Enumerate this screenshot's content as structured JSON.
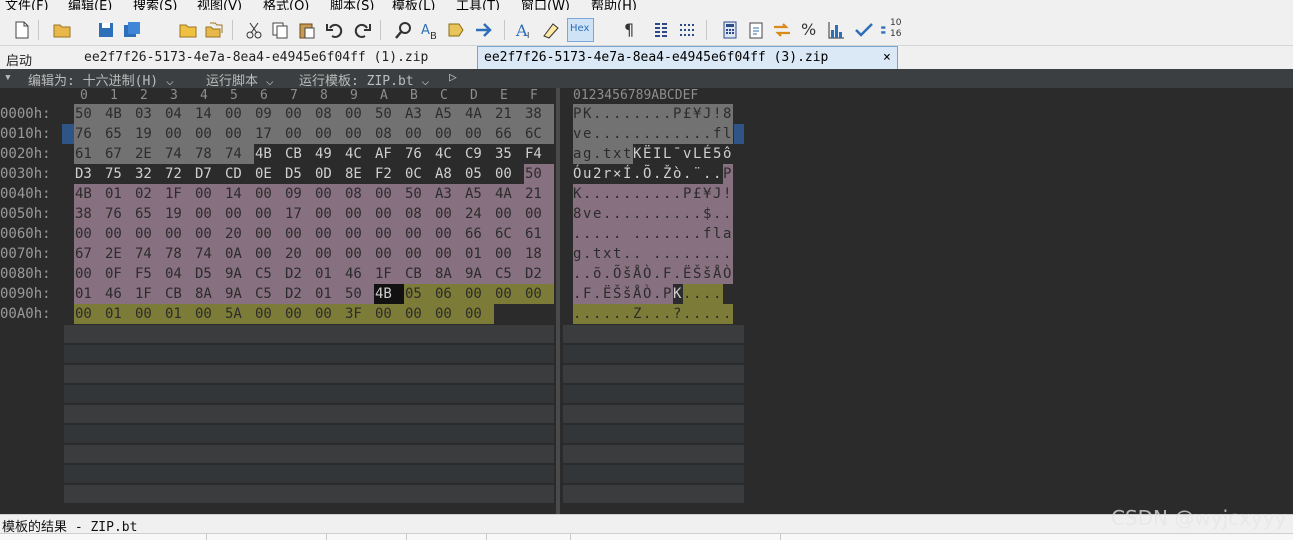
{
  "menu": [
    "文件(F)",
    "编辑(E)",
    "搜索(S)",
    "视图(V)",
    "格式(O)",
    "脚本(S)",
    "模板(L)",
    "工具(T)",
    "窗口(W)",
    "帮助(H)"
  ],
  "toolbar": {
    "icons": [
      "new-file-icon",
      "open-folder-icon",
      "save-icon",
      "save-all-icon",
      "folder-icon",
      "open-multiple-icon",
      "cut-icon",
      "copy-icon",
      "paste-icon",
      "undo-icon",
      "redo-icon",
      "find-icon",
      "find-replace-icon",
      "replace-icon",
      "goto-icon",
      "font-icon",
      "highlight-icon",
      "hex-view-icon",
      "paragraph-icon",
      "columns-icon",
      "binary-icon",
      "calculator-icon",
      "clipboard-icon",
      "compare-icon",
      "percent-icon",
      "histogram-icon",
      "checksum-icon",
      "base-converter-icon"
    ],
    "hex_label": "Hex",
    "paragraph_glyph": "¶",
    "percent_glyph": "%",
    "base_top": "10",
    "base_bottom": "16"
  },
  "tabs": {
    "start": "启动",
    "file1": "ee2f7f26-5173-4e7a-8ea4-e4945e6f04ff (1).zip",
    "file3": "ee2f7f26-5173-4e7a-8ea4-e4945e6f04ff (3).zip",
    "close": "×"
  },
  "options": {
    "collapse": "▾",
    "edit_as": "编辑为: 十六进制(H) ⌵",
    "run_script": "运行脚本 ⌵",
    "run_template": "运行模板: ZIP.bt ⌵",
    "play": "▷"
  },
  "column_headers": [
    "0",
    "1",
    "2",
    "3",
    "4",
    "5",
    "6",
    "7",
    "8",
    "9",
    "A",
    "B",
    "C",
    "D",
    "E",
    "F"
  ],
  "ascii_header": "0123456789ABCDEF",
  "rows": [
    {
      "addr": "0000h:",
      "bytes": [
        "50",
        "4B",
        "03",
        "04",
        "14",
        "00",
        "09",
        "00",
        "08",
        "00",
        "50",
        "A3",
        "A5",
        "4A",
        "21",
        "38"
      ],
      "ascii": "PK........P£¥J!8"
    },
    {
      "addr": "0010h:",
      "bytes": [
        "76",
        "65",
        "19",
        "00",
        "00",
        "00",
        "17",
        "00",
        "00",
        "00",
        "08",
        "00",
        "00",
        "00",
        "66",
        "6C"
      ],
      "ascii": "ve............fl"
    },
    {
      "addr": "0020h:",
      "bytes": [
        "61",
        "67",
        "2E",
        "74",
        "78",
        "74",
        "4B",
        "CB",
        "49",
        "4C",
        "AF",
        "76",
        "4C",
        "C9",
        "35",
        "F4"
      ],
      "ascii": "ag.txtKËIL¯vLÉ5ô"
    },
    {
      "addr": "0030h:",
      "bytes": [
        "D3",
        "75",
        "32",
        "72",
        "D7",
        "CD",
        "0E",
        "D5",
        "0D",
        "8E",
        "F2",
        "0C",
        "A8",
        "05",
        "00",
        "50"
      ],
      "ascii": "Óu2r×Í.Õ.Žò.¨..P"
    },
    {
      "addr": "0040h:",
      "bytes": [
        "4B",
        "01",
        "02",
        "1F",
        "00",
        "14",
        "00",
        "09",
        "00",
        "08",
        "00",
        "50",
        "A3",
        "A5",
        "4A",
        "21"
      ],
      "ascii": "K..........P£¥J!"
    },
    {
      "addr": "0050h:",
      "bytes": [
        "38",
        "76",
        "65",
        "19",
        "00",
        "00",
        "00",
        "17",
        "00",
        "00",
        "00",
        "08",
        "00",
        "24",
        "00",
        "00"
      ],
      "ascii": "8ve..........$.."
    },
    {
      "addr": "0060h:",
      "bytes": [
        "00",
        "00",
        "00",
        "00",
        "00",
        "20",
        "00",
        "00",
        "00",
        "00",
        "00",
        "00",
        "00",
        "66",
        "6C",
        "61"
      ],
      "ascii": "..... .......fla"
    },
    {
      "addr": "0070h:",
      "bytes": [
        "67",
        "2E",
        "74",
        "78",
        "74",
        "0A",
        "00",
        "20",
        "00",
        "00",
        "00",
        "00",
        "00",
        "01",
        "00",
        "18"
      ],
      "ascii": "g.txt.. ........"
    },
    {
      "addr": "0080h:",
      "bytes": [
        "00",
        "0F",
        "F5",
        "04",
        "D5",
        "9A",
        "C5",
        "D2",
        "01",
        "46",
        "1F",
        "CB",
        "8A",
        "9A",
        "C5",
        "D2"
      ],
      "ascii": "..õ.ÕšÅÒ.F.ËŠšÅÒ"
    },
    {
      "addr": "0090h:",
      "bytes": [
        "01",
        "46",
        "1F",
        "CB",
        "8A",
        "9A",
        "C5",
        "D2",
        "01",
        "50",
        "4B",
        "05",
        "06",
        "00",
        "00",
        "00"
      ],
      "ascii": ".F.ËŠšÅÒ.PK...."
    },
    {
      "addr": "00A0h:",
      "bytes": [
        "00",
        "01",
        "00",
        "01",
        "00",
        "5A",
        "00",
        "00",
        "00",
        "3F",
        "00",
        "00",
        "00",
        "00"
      ],
      "ascii": "......Z...?....."
    }
  ],
  "output_title": "模板的结果 - ZIP.bt",
  "watermark": "CSDN @wyjcxyyy",
  "colors": {
    "gray": "#727272",
    "mauve": "#87707f",
    "olive": "#7c7b37",
    "cursor_row": "#2f5587"
  }
}
